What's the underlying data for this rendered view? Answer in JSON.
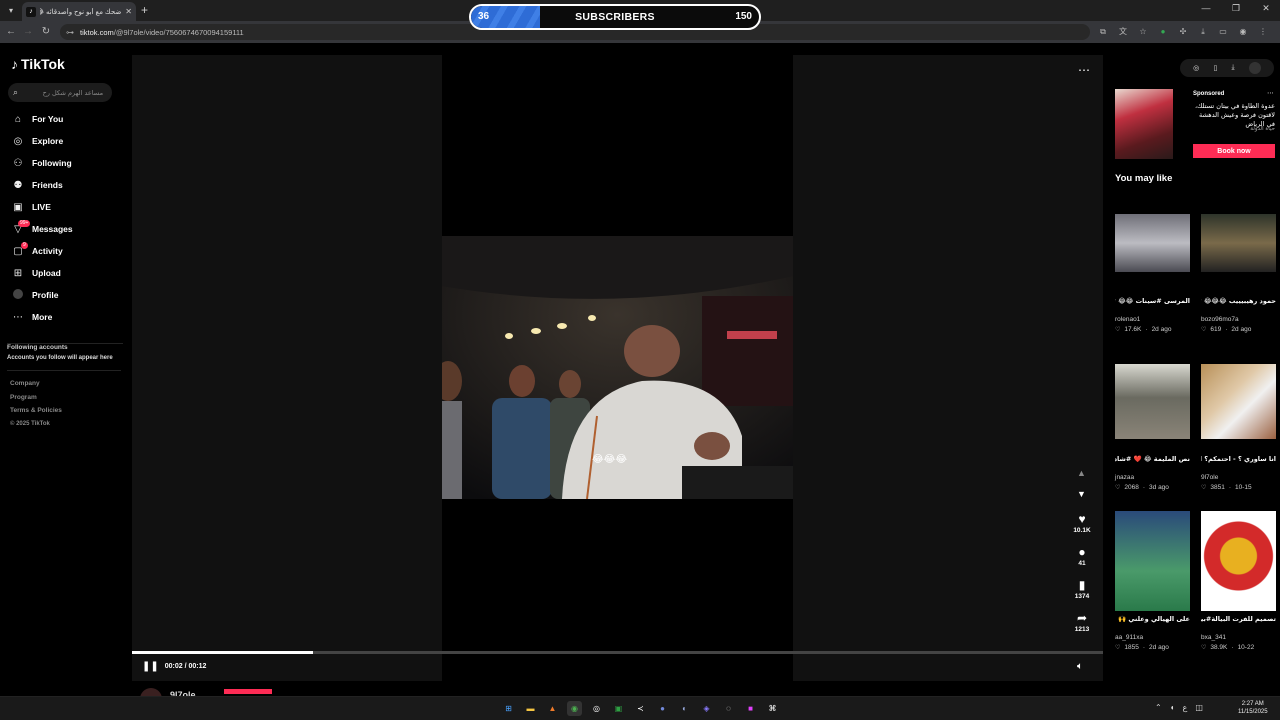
{
  "browser": {
    "tab_title": "ضحك مع أبو نوح وأصدقائه 😂",
    "tab_favicon": "tiktok-icon",
    "url_host": "tiktok.com",
    "url_path": "/@9l7ole/video/7560674670094159111",
    "window_controls": [
      "minimize-icon",
      "restore-icon",
      "close-icon"
    ]
  },
  "subscriber_overlay": {
    "current": "36",
    "label": "SUBSCRIBERS",
    "goal": "150",
    "progress": 0.24
  },
  "sidebar": {
    "logo": "TikTok",
    "search_placeholder": "مساعد الهرم شكل رح",
    "items": [
      {
        "label": "For You",
        "icon": "home-icon"
      },
      {
        "label": "Explore",
        "icon": "compass-icon"
      },
      {
        "label": "Following",
        "icon": "following-icon"
      },
      {
        "label": "Friends",
        "icon": "friends-icon"
      },
      {
        "label": "LIVE",
        "icon": "live-icon"
      },
      {
        "label": "Messages",
        "icon": "messages-icon",
        "badge": "99+"
      },
      {
        "label": "Activity",
        "icon": "activity-icon",
        "badge": "9"
      },
      {
        "label": "Upload",
        "icon": "upload-icon"
      },
      {
        "label": "Profile",
        "icon": "profile-avatar"
      },
      {
        "label": "More",
        "icon": "more-icon"
      }
    ],
    "following_title": "Following accounts",
    "following_sub": "Accounts you follow will appear here",
    "footer": [
      "Company",
      "Program",
      "Terms & Policies",
      "© 2025 TikTok"
    ]
  },
  "video": {
    "caption_overlay": "😂😂😂",
    "time": "00:02 / 00:12",
    "progress": 0.186,
    "likes": "10.1K",
    "comments": "41",
    "saves": "1374",
    "shares": "1213",
    "author": "9l7ole"
  },
  "right_panel": {
    "ad": {
      "sponsored": "Sponsored",
      "text": "عدوة الطاوة في بيتان تستلك، لاقتون فرصة وعيش الدهشة في الرياض",
      "brand": "حياة الدولة",
      "cta": "Book now"
    },
    "section_title": "You may like",
    "videos": [
      {
        "caption": "المرسى #سينات 😂😂 #explore #fyp",
        "user": "rolenao1",
        "likes": "17.6K",
        "date": "2d ago"
      },
      {
        "caption": "حمود رهيبيييب 😂😂😂 #عبدالصمد_القرشي",
        "user": "bozo96mo7a",
        "likes": "619",
        "date": "2d ago"
      },
      {
        "caption": "نص المليمة 😂 ❤️ #شادر_ريجيك",
        "user": "jnazaa",
        "likes": "2068",
        "date": "3d ago"
      },
      {
        "caption": "انا ساوري ؟ - احتمكم؟ الزار ماتت بمصالي و بتشرفون",
        "user": "9l7ole",
        "likes": "3851",
        "date": "10-15"
      },
      {
        "caption": "على الهيالي وعلني 🙌 🖐 🖐 😂 ❤️ 👍",
        "user": "aa_911xa",
        "likes": "1855",
        "date": "2d ago"
      },
      {
        "caption": "تصميم للفرت البيالة#بيالة #تصميم #fyp #edit",
        "user": "bxa_341",
        "likes": "38.9K",
        "date": "10-22"
      }
    ]
  },
  "taskbar": {
    "time": "2:27 AM",
    "date": "11/15/2025"
  }
}
